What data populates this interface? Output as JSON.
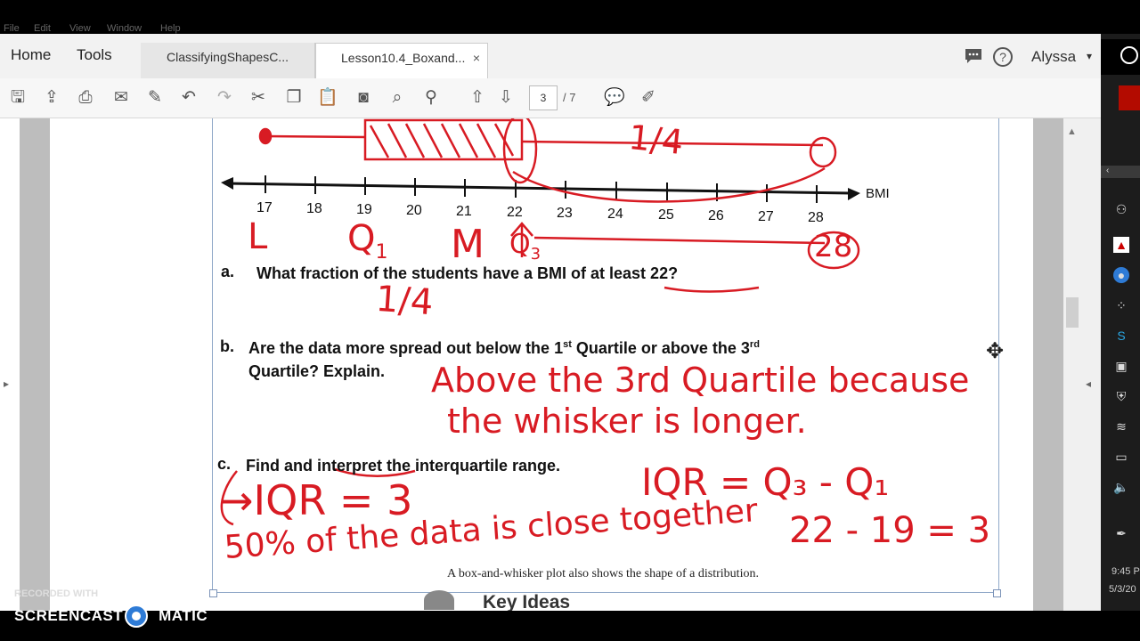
{
  "menubar": [
    "File",
    "Edit",
    "View",
    "Window",
    "Help"
  ],
  "nav": {
    "home": "Home",
    "tools": "Tools"
  },
  "tabs": [
    {
      "label": "ClassifyingShapesC..."
    },
    {
      "label": "Lesson10.4_Boxand...",
      "close": "×"
    }
  ],
  "user": {
    "name": "Alyssa"
  },
  "toolbar": {
    "page_current": "3",
    "page_total": "/ 7"
  },
  "document": {
    "axis_label": "BMI",
    "ticks": [
      "17",
      "18",
      "19",
      "20",
      "21",
      "22",
      "23",
      "24",
      "25",
      "26",
      "27",
      "28"
    ],
    "qa_label": "a.",
    "qa_text": "What fraction of the students have a BMI of at least 22?",
    "qb_label": "b.",
    "qb_text1": "Are the data more spread out below the 1",
    "qb_sup1": "st",
    "qb_text2": " Quartile or above the 3",
    "qb_sup2": "rd",
    "qb_text3": "Quartile? Explain.",
    "qc_label": "c.",
    "qc_text": "Find and interpret the interquartile range.",
    "footer_text": "A box-and-whisker plot also shows the shape of a distribution.",
    "key_ideas": "Key Ideas"
  },
  "handwriting": {
    "L": "L",
    "Q1": "Q",
    "Q1sub": "1",
    "M": "M",
    "Q3": "Q",
    "Q3sub": "3",
    "max": "28",
    "fraction": "1/4",
    "quarter_top": "1/4",
    "answer_b1": "Above the 3rd Quartile because",
    "answer_b2": "the whisker is longer.",
    "iqr_formula": "IQR = Q₃ - Q₁",
    "iqr_calc": "22 - 19 = 3",
    "iqr_value": "→IQR = 3",
    "interpretation": "50% of the data is close together"
  },
  "watermark": {
    "small": "RECORDED WITH",
    "big_left": "SCREENCAST",
    "big_right": "MATIC"
  },
  "clock": {
    "time": "9:45 P",
    "date": "5/3/20"
  },
  "colors": {
    "ink": "#d81b23",
    "accent": "#2e7bd6"
  }
}
